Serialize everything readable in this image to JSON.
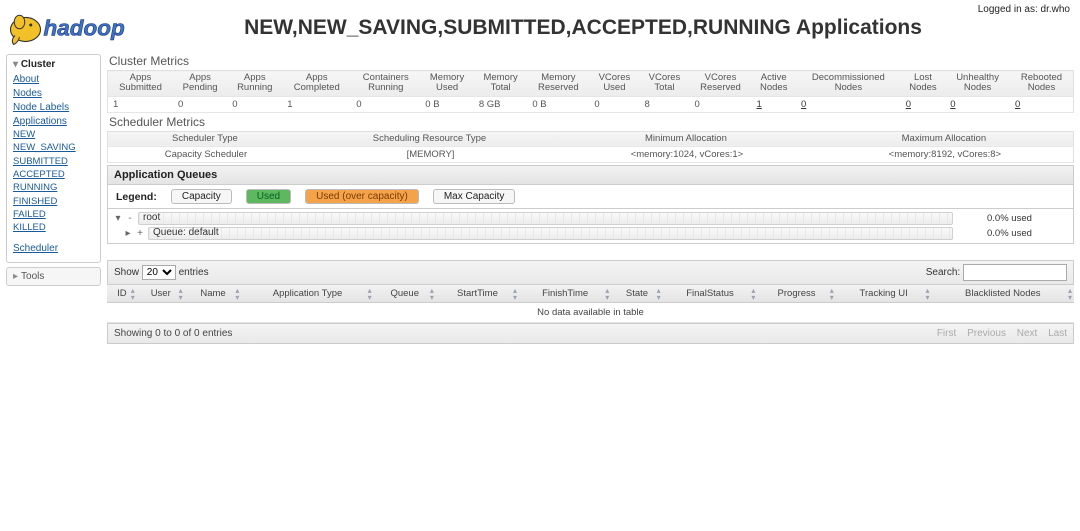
{
  "login_prefix": "Logged in as: ",
  "login_user": "dr.who",
  "page_title": "NEW,NEW_SAVING,SUBMITTED,ACCEPTED,RUNNING Applications",
  "logo_text": "hadoop",
  "sidebar": {
    "cluster_label": "Cluster",
    "items": [
      "About",
      "Nodes",
      "Node Labels",
      "Applications"
    ],
    "app_states": [
      "NEW",
      "NEW_SAVING",
      "SUBMITTED",
      "ACCEPTED",
      "RUNNING",
      "FINISHED",
      "FAILED",
      "KILLED"
    ],
    "scheduler_label": "Scheduler",
    "tools_label": "Tools"
  },
  "sections": {
    "cluster_metrics": "Cluster Metrics",
    "scheduler_metrics": "Scheduler Metrics",
    "app_queues": "Application Queues"
  },
  "cluster_metrics": {
    "headers": [
      "Apps Submitted",
      "Apps Pending",
      "Apps Running",
      "Apps Completed",
      "Containers Running",
      "Memory Used",
      "Memory Total",
      "Memory Reserved",
      "VCores Used",
      "VCores Total",
      "VCores Reserved",
      "Active Nodes",
      "Decommissioned Nodes",
      "Lost Nodes",
      "Unhealthy Nodes",
      "Rebooted Nodes"
    ],
    "values": [
      "1",
      "0",
      "0",
      "1",
      "0",
      "0 B",
      "8 GB",
      "0 B",
      "0",
      "8",
      "0",
      "1",
      "0",
      "0",
      "0",
      "0"
    ]
  },
  "scheduler_metrics": {
    "headers": [
      "Scheduler Type",
      "Scheduling Resource Type",
      "Minimum Allocation",
      "Maximum Allocation"
    ],
    "values": [
      "Capacity Scheduler",
      "[MEMORY]",
      "<memory:1024, vCores:1>",
      "<memory:8192, vCores:8>"
    ]
  },
  "legend": {
    "label": "Legend:",
    "capacity": "Capacity",
    "used": "Used",
    "over": "Used (over capacity)",
    "max": "Max Capacity"
  },
  "queues": {
    "root": {
      "kind": "-",
      "label": "root",
      "used": "0.0% used"
    },
    "default": {
      "kind": "+",
      "label": "Queue: default",
      "used": "0.0% used"
    }
  },
  "datatable": {
    "show_prefix": "Show",
    "show_suffix": "entries",
    "show_value": "20",
    "search_label": "Search:",
    "headers": [
      "ID",
      "User",
      "Name",
      "Application Type",
      "Queue",
      "StartTime",
      "FinishTime",
      "State",
      "FinalStatus",
      "Progress",
      "Tracking UI",
      "Blacklisted Nodes"
    ],
    "empty": "No data available in table",
    "info": "Showing 0 to 0 of 0 entries",
    "pager": {
      "first": "First",
      "prev": "Previous",
      "next": "Next",
      "last": "Last"
    }
  }
}
